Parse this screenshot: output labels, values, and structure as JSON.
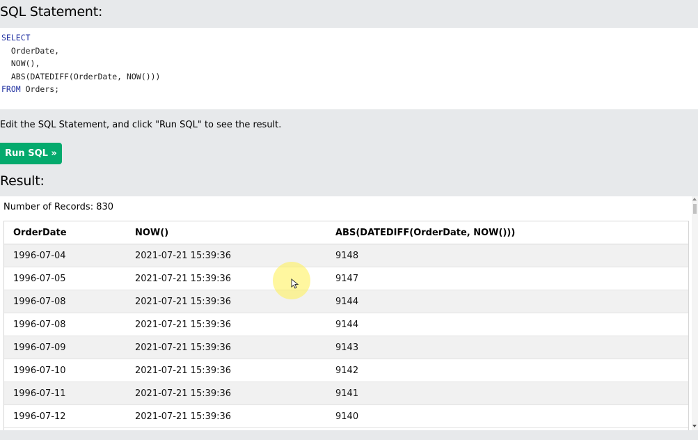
{
  "sql_section": {
    "heading": "SQL Statement:",
    "code_lines": [
      {
        "keyword": "SELECT",
        "text": ""
      },
      {
        "keyword": "",
        "text": "  OrderDate,"
      },
      {
        "keyword": "",
        "text": "  NOW(),"
      },
      {
        "keyword": "",
        "text": "  ABS(DATEDIFF(OrderDate, NOW()))"
      },
      {
        "keyword": "FROM",
        "text": " Orders;"
      }
    ]
  },
  "instructions": "Edit the SQL Statement, and click \"Run SQL\" to see the result.",
  "run_button": {
    "label": "Run SQL »"
  },
  "result_section": {
    "heading": "Result:",
    "record_count_text": "Number of Records: 830",
    "columns": [
      "OrderDate",
      "NOW()",
      "ABS(DATEDIFF(OrderDate, NOW()))"
    ],
    "rows": [
      [
        "1996-07-04",
        "2021-07-21 15:39:36",
        "9148"
      ],
      [
        "1996-07-05",
        "2021-07-21 15:39:36",
        "9147"
      ],
      [
        "1996-07-08",
        "2021-07-21 15:39:36",
        "9144"
      ],
      [
        "1996-07-08",
        "2021-07-21 15:39:36",
        "9144"
      ],
      [
        "1996-07-09",
        "2021-07-21 15:39:36",
        "9143"
      ],
      [
        "1996-07-10",
        "2021-07-21 15:39:36",
        "9142"
      ],
      [
        "1996-07-11",
        "2021-07-21 15:39:36",
        "9141"
      ],
      [
        "1996-07-12",
        "2021-07-21 15:39:36",
        "9140"
      ]
    ]
  },
  "colors": {
    "run_button": "#04aa6d",
    "page_background": "#e7e9eb",
    "sql_keyword": "#1f2fa0"
  }
}
